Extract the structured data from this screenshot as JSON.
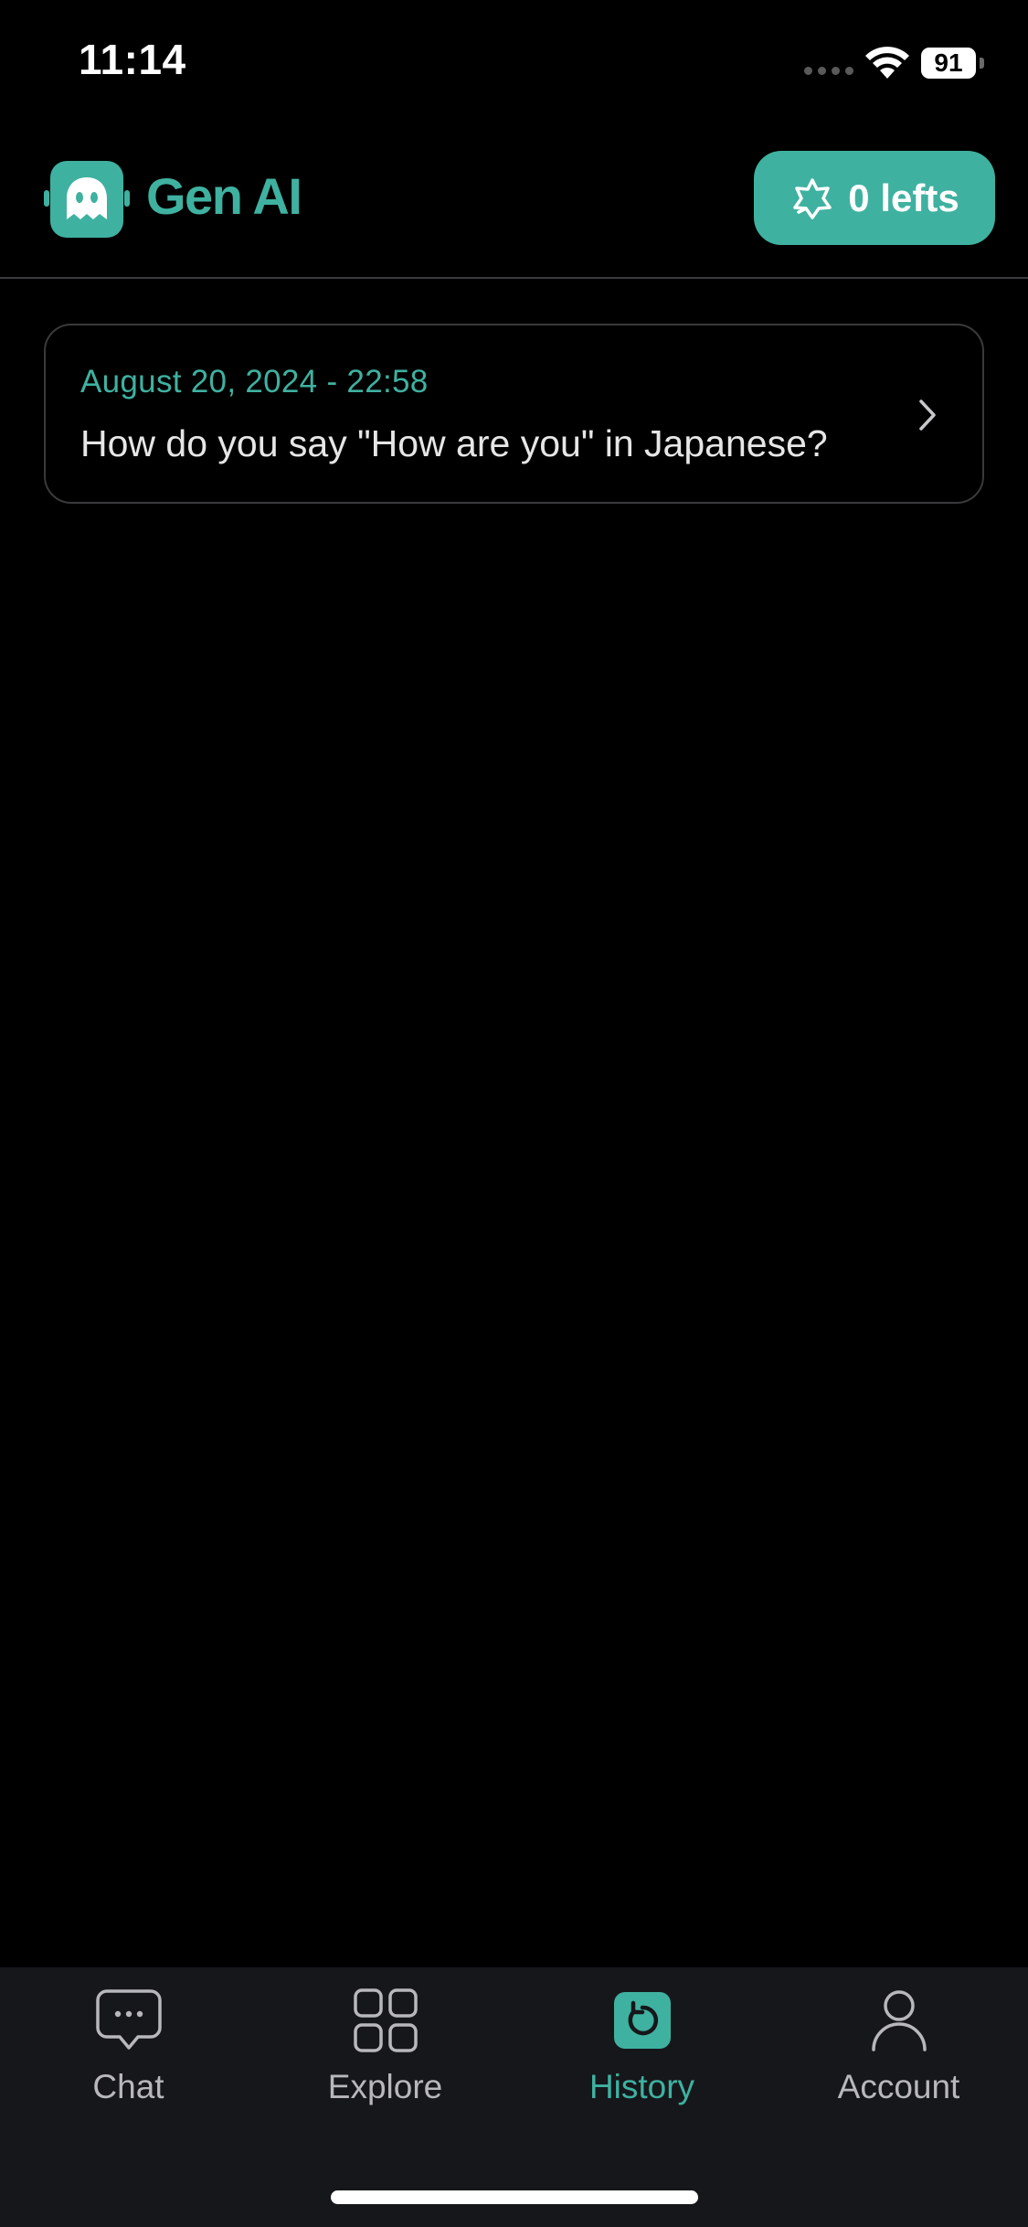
{
  "status_bar": {
    "time": "11:14",
    "battery": "91",
    "icons": [
      "signal-dots",
      "wifi-icon",
      "battery-icon"
    ]
  },
  "header": {
    "app_title": "Gen AI",
    "logo_icon": "ghost-chat-logo-icon",
    "credits_label": "0 lefts",
    "credits_icon": "badge-star-icon"
  },
  "history": {
    "items": [
      {
        "date": "August 20, 2024 - 22:58",
        "question": "How do you say \"How are you\" in Japanese?"
      }
    ]
  },
  "tab_bar": {
    "tabs": [
      {
        "label": "Chat",
        "icon": "chat-bubble-icon",
        "active": false
      },
      {
        "label": "Explore",
        "icon": "grid-icon",
        "active": false
      },
      {
        "label": "History",
        "icon": "history-icon",
        "active": true
      },
      {
        "label": "Account",
        "icon": "person-icon",
        "active": false
      }
    ]
  },
  "colors": {
    "accent": "#3fb1a0",
    "background": "#000000",
    "tab_bar_background": "#16171b",
    "card_border": "#3a3a3c",
    "inactive_tab": "#b8b8bc"
  }
}
